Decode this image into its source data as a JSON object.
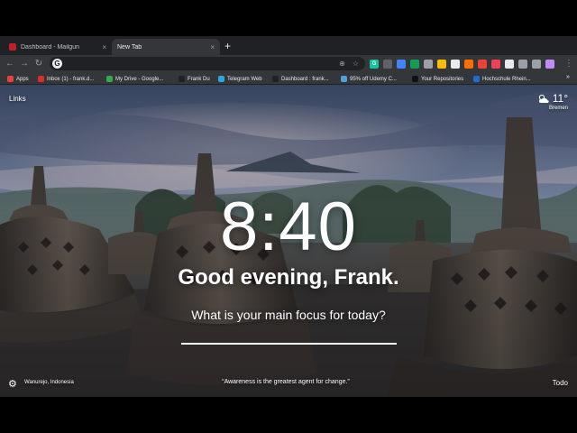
{
  "browser": {
    "tabs": [
      {
        "label": "Dashboard - Mailgun",
        "close": "×",
        "active": false
      },
      {
        "label": "New Tab",
        "close": "×",
        "active": true
      }
    ],
    "new_tab": "+",
    "address_value": "",
    "bookmarks": [
      {
        "label": "Apps",
        "icon": "apps-grid-icon",
        "color": "#ea4335"
      },
      {
        "label": "Inbox (1) - frank.d...",
        "icon": "gmail-icon",
        "color": "#d93025"
      },
      {
        "label": "My Drive - Google...",
        "icon": "drive-icon",
        "color": "#34a853"
      },
      {
        "label": "Frank Du",
        "icon": "bookmark-icon",
        "color": "#202124"
      },
      {
        "label": "Telegram Web",
        "icon": "telegram-icon",
        "color": "#2ca5e0"
      },
      {
        "label": "Dashboard : frank...",
        "icon": "dashboard-icon",
        "color": "#202124"
      },
      {
        "label": "95% off Udemy C...",
        "icon": "udemy-icon",
        "color": "#4aa3df"
      },
      {
        "label": "Your Repositories",
        "icon": "github-icon",
        "color": "#111111"
      },
      {
        "label": "Hochschule Rhein...",
        "icon": "school-icon",
        "color": "#1c6fd1"
      }
    ],
    "bookmarks_more": "»",
    "extensions": [
      {
        "icon": "grammarly-icon",
        "color": "#15c39a",
        "glyph": "G"
      },
      {
        "icon": "extension-icon",
        "color": "#5f6368",
        "glyph": ""
      },
      {
        "icon": "lite-icon",
        "color": "#4285f4",
        "glyph": ""
      },
      {
        "icon": "green-dot-icon",
        "color": "#0f9d58",
        "glyph": ""
      },
      {
        "icon": "reader-icon",
        "color": "#9aa0a6",
        "glyph": ""
      },
      {
        "icon": "sb-icon",
        "color": "#fbbc04",
        "glyph": ""
      },
      {
        "icon": "shield-icon",
        "color": "#e8eaed",
        "glyph": ""
      },
      {
        "icon": "flame-icon",
        "color": "#ff6d00",
        "glyph": ""
      },
      {
        "icon": "red-icon",
        "color": "#ea4335",
        "glyph": ""
      },
      {
        "icon": "pocket-icon",
        "color": "#ef4056",
        "glyph": ""
      },
      {
        "icon": "flag-icon",
        "color": "#e8eaed",
        "glyph": ""
      },
      {
        "icon": "circle-icon",
        "color": "#9aa0a6",
        "glyph": ""
      },
      {
        "icon": "puzzle-icon",
        "color": "#9aa0a6",
        "glyph": ""
      },
      {
        "icon": "avatar-icon",
        "color": "#c58af9",
        "glyph": ""
      }
    ],
    "menu": "⋮"
  },
  "momentum": {
    "links": "Links",
    "weather": {
      "temp": "11°",
      "city": "Bremen",
      "icon": "partly-cloudy-icon"
    },
    "time": "8:40",
    "greeting": "Good evening, Frank.",
    "focus_prompt": "What is your main focus for today?",
    "focus_value": "",
    "location": "Wanurejo, Indonesia",
    "quote": "“Awareness is the greatest agent for change.”",
    "todo": "Todo"
  }
}
